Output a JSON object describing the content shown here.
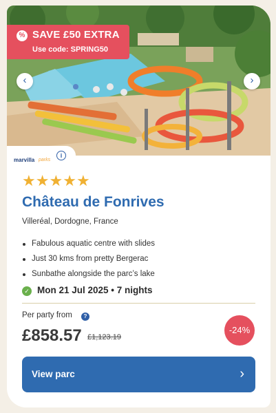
{
  "promo": {
    "title": "SAVE £50 EXTRA",
    "code": "Use code: SPRING50",
    "icon": "percent-tag-icon",
    "color": "#e5505e"
  },
  "gallery": {
    "prev_icon": "chevron-left-icon",
    "next_icon": "chevron-right-icon",
    "prev_glyph": "‹",
    "next_glyph": "›"
  },
  "brand": {
    "name": "marvilla",
    "suffix": "parks",
    "info_glyph": "i"
  },
  "rating": {
    "stars": 5,
    "glyph": "★",
    "color": "#f0b133"
  },
  "property": {
    "name": "Château de Fonrives",
    "location": "Villeréal, Dordogne, France",
    "features": [
      "Fabulous aquatic centre with slides",
      "Just 30 kms from pretty Bergerac",
      "Sunbathe alongside the parc’s lake"
    ]
  },
  "booking": {
    "check_glyph": "✓",
    "date_text": "Mon 21 Jul 2025 • 7 nights"
  },
  "pricing": {
    "label": "Per party from",
    "help_glyph": "?",
    "price": "£858.57",
    "old_price": "£1,123.19",
    "discount": "-24%"
  },
  "cta": {
    "label": "View parc",
    "chevron": "›",
    "color": "#2f6bb0"
  }
}
